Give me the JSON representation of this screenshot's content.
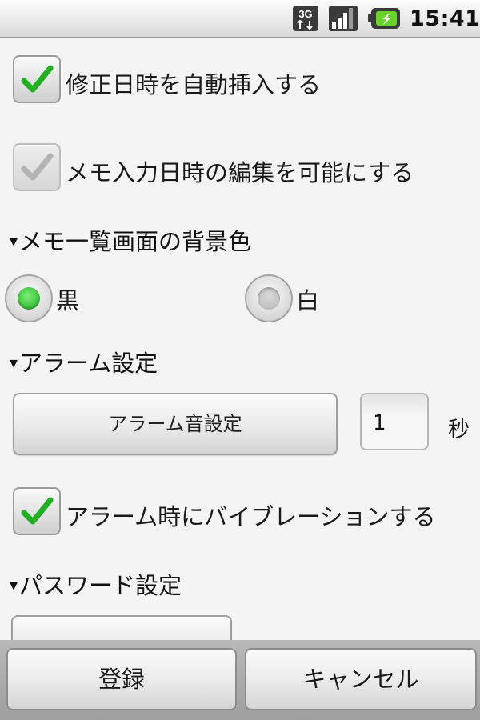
{
  "status_bar": {
    "network_badge": "3G",
    "time": "15:41",
    "icons": [
      "network-3g-icon",
      "signal-strength-icon",
      "battery-charging-icon"
    ]
  },
  "settings": {
    "auto_insert_date": {
      "label": "修正日時を自動挿入する",
      "checked": true,
      "enabled": true
    },
    "editable_memo_date": {
      "label": "メモ入力日時の編集を可能にする",
      "checked": true,
      "enabled": false
    },
    "background_section": {
      "title": "メモ一覧画面の背景色",
      "options": [
        {
          "label": "黒",
          "selected": true
        },
        {
          "label": "白",
          "selected": false
        }
      ]
    },
    "alarm_section": {
      "title": "アラーム設定",
      "sound_button": "アラーム音設定",
      "seconds_value": "1",
      "seconds_unit": "秒"
    },
    "vibration": {
      "label": "アラーム時にバイブレーションする",
      "checked": true,
      "enabled": true
    },
    "password_section": {
      "title": "パスワード設定",
      "triangle": "▾"
    }
  },
  "footer": {
    "register_label": "登録",
    "cancel_label": "キャンセル"
  },
  "colors": {
    "check_green": "#22b022",
    "radio_green": "#1aa31a",
    "background": "#f4f4f4"
  }
}
